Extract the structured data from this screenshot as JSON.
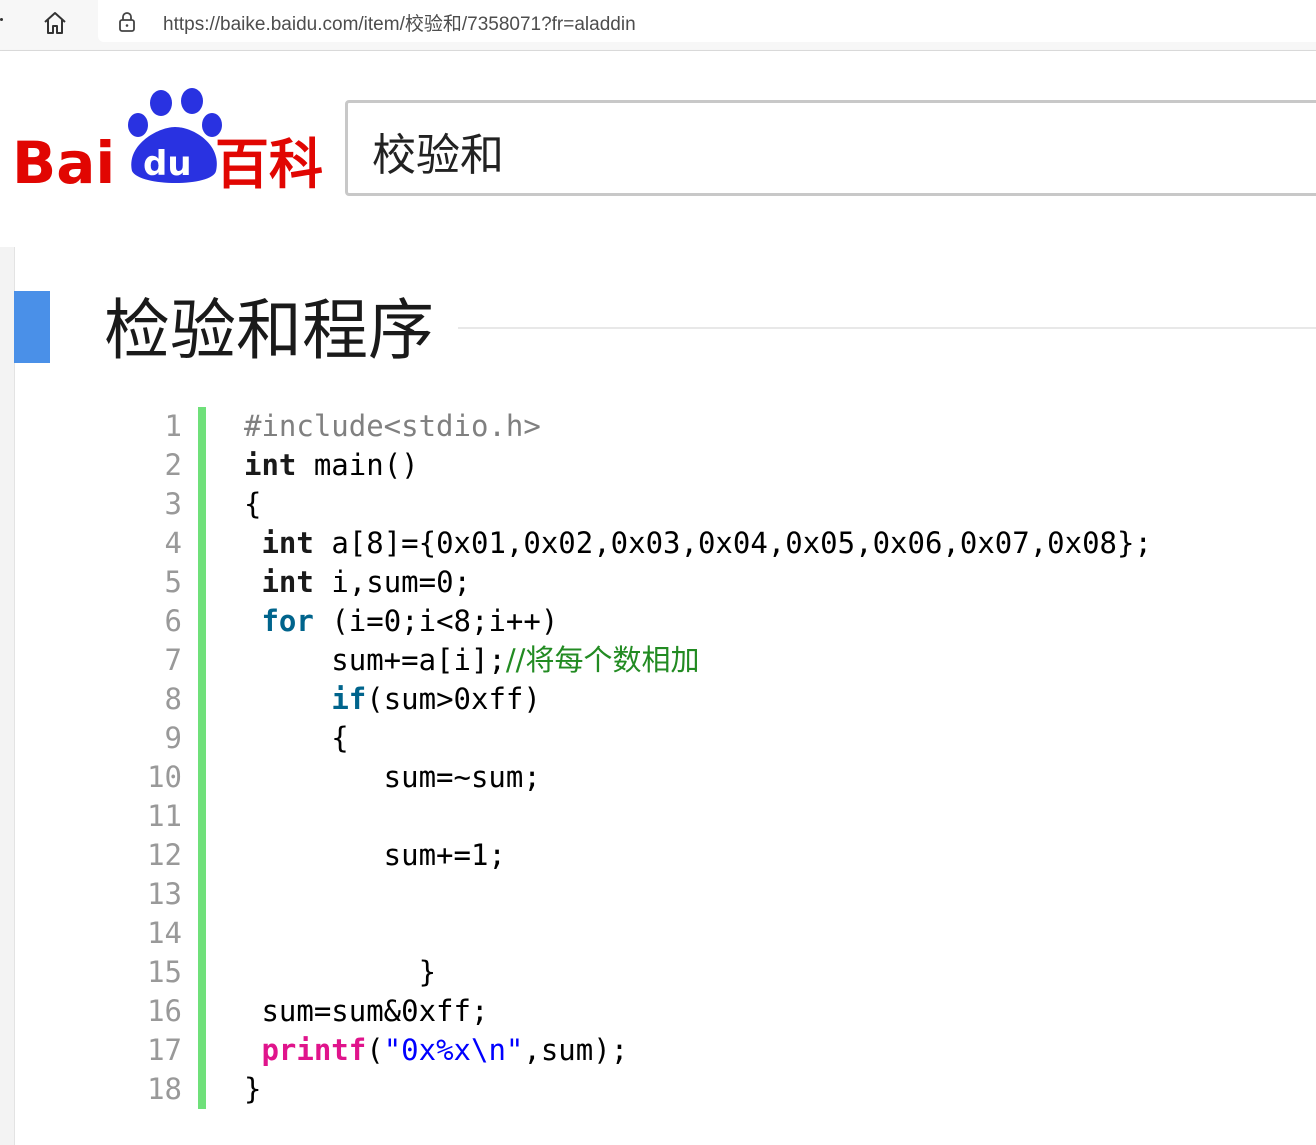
{
  "browser": {
    "url": "https://baike.baidu.com/item/校验和/7358071?fr=aladdin"
  },
  "header": {
    "logo_text": "Baidu百科",
    "search_value": "校验和"
  },
  "section": {
    "title": "检验和程序"
  },
  "code": {
    "line_numbers": [
      "1",
      "2",
      "3",
      "4",
      "5",
      "6",
      "7",
      "8",
      "9",
      "10",
      "11",
      "12",
      "13",
      "14",
      "15",
      "16",
      "17",
      "18"
    ],
    "lines": [
      [
        {
          "t": "#include<stdio.h>",
          "c": "pp"
        }
      ],
      [
        {
          "t": "int",
          "c": "kw"
        },
        {
          "t": " main()",
          "c": ""
        }
      ],
      [
        {
          "t": "{",
          "c": ""
        }
      ],
      [
        {
          "t": " ",
          "c": ""
        },
        {
          "t": "int",
          "c": "kw"
        },
        {
          "t": " a[8]={0x01,0x02,0x03,0x04,0x05,0x06,0x07,0x08};",
          "c": ""
        }
      ],
      [
        {
          "t": " ",
          "c": ""
        },
        {
          "t": "int",
          "c": "kw"
        },
        {
          "t": " i,sum=0;",
          "c": ""
        }
      ],
      [
        {
          "t": " ",
          "c": ""
        },
        {
          "t": "for",
          "c": "kb"
        },
        {
          "t": " (i=0;i<8;i++)",
          "c": ""
        }
      ],
      [
        {
          "t": "     sum+=a[i];",
          "c": ""
        },
        {
          "t": "//将每个数相加",
          "c": "cm"
        }
      ],
      [
        {
          "t": "     ",
          "c": ""
        },
        {
          "t": "if",
          "c": "kb"
        },
        {
          "t": "(sum>0xff)",
          "c": ""
        }
      ],
      [
        {
          "t": "     {",
          "c": ""
        }
      ],
      [
        {
          "t": "        sum=~sum;",
          "c": ""
        }
      ],
      [
        {
          "t": "",
          "c": ""
        }
      ],
      [
        {
          "t": "        sum+=1;",
          "c": ""
        }
      ],
      [
        {
          "t": "",
          "c": ""
        }
      ],
      [
        {
          "t": "",
          "c": ""
        }
      ],
      [
        {
          "t": "          }",
          "c": ""
        }
      ],
      [
        {
          "t": " sum=sum&0xff;",
          "c": ""
        }
      ],
      [
        {
          "t": " ",
          "c": ""
        },
        {
          "t": "printf",
          "c": "fn"
        },
        {
          "t": "(",
          "c": ""
        },
        {
          "t": "\"0x%x\\n\"",
          "c": "st"
        },
        {
          "t": ",sum);",
          "c": ""
        }
      ],
      [
        {
          "t": "}",
          "c": ""
        }
      ]
    ]
  },
  "colors": {
    "brand_red": "#e10602",
    "brand_blue": "#2932e1",
    "heading_mark": "#4a90e8",
    "code_bar": "#6fe07a"
  }
}
